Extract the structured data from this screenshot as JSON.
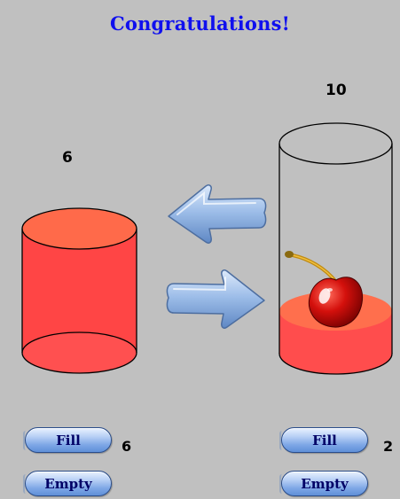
{
  "header": {
    "title": "Congratulations!"
  },
  "left_jug": {
    "capacity_label": "6",
    "current_amount": "6",
    "fill_fraction": 1.0,
    "fill_label": "Fill",
    "empty_label": "Empty",
    "liquid_color": "#ff4040"
  },
  "right_jug": {
    "capacity_label": "10",
    "current_amount": "2",
    "fill_fraction": 0.2,
    "fill_label": "Fill",
    "empty_label": "Empty",
    "liquid_color": "#ff4d4d"
  },
  "arrows": {
    "pour_left_icon": "arrow-left-icon",
    "pour_right_icon": "arrow-right-icon",
    "color": "#7fa7dd"
  },
  "reward": {
    "icon": "cherry-icon"
  }
}
